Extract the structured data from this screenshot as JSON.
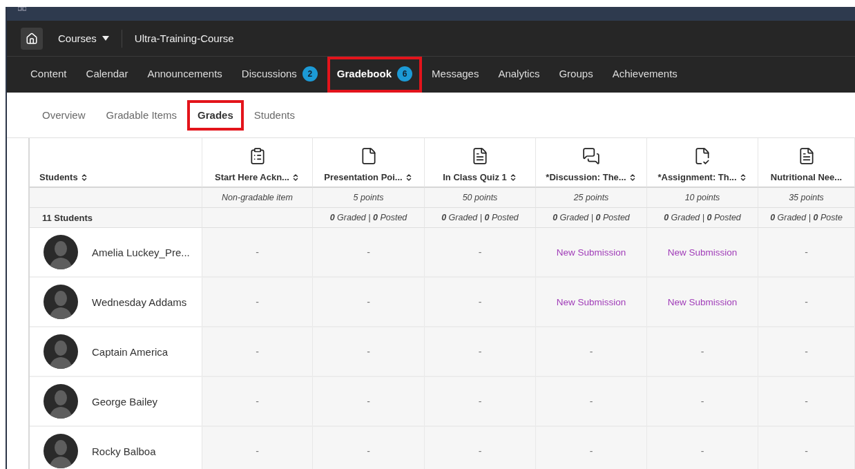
{
  "top_nav": {
    "courses_label": "Courses",
    "course_title": "Ultra-Training-Course"
  },
  "tabs": [
    {
      "label": "Content",
      "selected": false,
      "highlighted": false
    },
    {
      "label": "Calendar",
      "selected": false,
      "highlighted": false
    },
    {
      "label": "Announcements",
      "selected": false,
      "highlighted": false
    },
    {
      "label": "Discussions",
      "badge": "2",
      "selected": false,
      "highlighted": false
    },
    {
      "label": "Gradebook",
      "badge": "6",
      "selected": true,
      "highlighted": true
    },
    {
      "label": "Messages",
      "selected": false,
      "highlighted": false
    },
    {
      "label": "Analytics",
      "selected": false,
      "highlighted": false
    },
    {
      "label": "Groups",
      "selected": false,
      "highlighted": false
    },
    {
      "label": "Achievements",
      "selected": false,
      "highlighted": false
    }
  ],
  "subtabs": [
    {
      "label": "Overview",
      "selected": false,
      "highlighted": false
    },
    {
      "label": "Gradable Items",
      "selected": false,
      "highlighted": false
    },
    {
      "label": "Grades",
      "selected": true,
      "highlighted": true
    },
    {
      "label": "Students",
      "selected": false,
      "highlighted": false
    }
  ],
  "table": {
    "student_header": "Students",
    "student_count": "11 Students",
    "columns": [
      {
        "kind": "clipboard",
        "title": "Start Here Ackn...",
        "sortable": true,
        "points": "Non-gradable item"
      },
      {
        "kind": "document",
        "title": "Presentation Poi...",
        "sortable": true,
        "points": "5 points",
        "status": "**0** Graded | **0** Posted"
      },
      {
        "kind": "test",
        "title": "In Class Quiz 1",
        "sortable": true,
        "points": "50 points",
        "status": "**0** Graded | **0** Posted"
      },
      {
        "kind": "discussion",
        "title": "*Discussion: The...",
        "sortable": true,
        "points": "25 points",
        "status": "**0** Graded | **0** Posted"
      },
      {
        "kind": "assignment",
        "title": "*Assignment: Th...",
        "sortable": true,
        "points": "10 points",
        "status": "**0** Graded | **0** Posted"
      },
      {
        "kind": "test",
        "title": "Nutritional Nee...",
        "sortable": false,
        "points": "35 points",
        "status": "**0** Graded | **0** Poste"
      }
    ],
    "rows": [
      {
        "name": "Amelia Luckey_Pre...",
        "cells": [
          {
            "kind": "empty",
            "text": "-"
          },
          {
            "kind": "empty",
            "text": "-"
          },
          {
            "kind": "empty",
            "text": "-"
          },
          {
            "kind": "submission",
            "text": "New Submission"
          },
          {
            "kind": "submission",
            "text": "New Submission"
          },
          {
            "kind": "empty",
            "text": "-"
          }
        ]
      },
      {
        "name": "Wednesday Addams",
        "cells": [
          {
            "kind": "empty",
            "text": "-"
          },
          {
            "kind": "empty",
            "text": "-"
          },
          {
            "kind": "empty",
            "text": "-"
          },
          {
            "kind": "submission",
            "text": "New Submission"
          },
          {
            "kind": "submission",
            "text": "New Submission"
          },
          {
            "kind": "empty",
            "text": "-"
          }
        ]
      },
      {
        "name": "Captain America",
        "cells": [
          {
            "kind": "empty",
            "text": "-"
          },
          {
            "kind": "empty",
            "text": "-"
          },
          {
            "kind": "empty",
            "text": "-"
          },
          {
            "kind": "empty",
            "text": "-"
          },
          {
            "kind": "empty",
            "text": "-"
          },
          {
            "kind": "empty",
            "text": "-"
          }
        ]
      },
      {
        "name": "George Bailey",
        "cells": [
          {
            "kind": "empty",
            "text": "-"
          },
          {
            "kind": "empty",
            "text": "-"
          },
          {
            "kind": "empty",
            "text": "-"
          },
          {
            "kind": "empty",
            "text": "-"
          },
          {
            "kind": "empty",
            "text": "-"
          },
          {
            "kind": "empty",
            "text": "-"
          }
        ]
      },
      {
        "name": "Rocky Balboa",
        "cells": [
          {
            "kind": "empty",
            "text": "-"
          },
          {
            "kind": "empty",
            "text": "-"
          },
          {
            "kind": "empty",
            "text": "-"
          },
          {
            "kind": "empty",
            "text": "-"
          },
          {
            "kind": "empty",
            "text": "-"
          },
          {
            "kind": "empty",
            "text": "-"
          }
        ]
      }
    ]
  }
}
